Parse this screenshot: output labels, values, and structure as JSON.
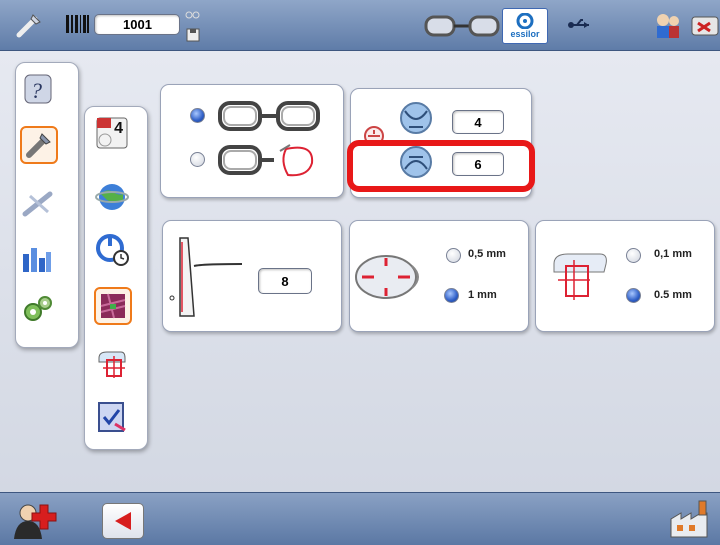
{
  "topbar": {
    "job_number": "1001",
    "brand": "essilor",
    "icons": [
      "tools-icon",
      "barcode-icon",
      "job-field",
      "glasses-icon",
      "floppy-icon",
      "essilor-logo",
      "usb-icon",
      "users-icon",
      "scanner-icon"
    ]
  },
  "lens_settings": {
    "value_top": "4",
    "value_bottom": "6"
  },
  "bevel_panel": {
    "value": "8"
  },
  "size_panel": {
    "option_1": "0,5 mm",
    "option_2": "1 mm",
    "selected": "1 mm"
  },
  "drill_panel": {
    "option_1": "0,1 mm",
    "option_2": "0.5 mm",
    "selected": "0.5 mm"
  },
  "calendar_badge": "4",
  "colors": {
    "highlight": "#e81818",
    "selected_tab": "#ef7a1a",
    "radio_on": "#2f5fc7"
  }
}
